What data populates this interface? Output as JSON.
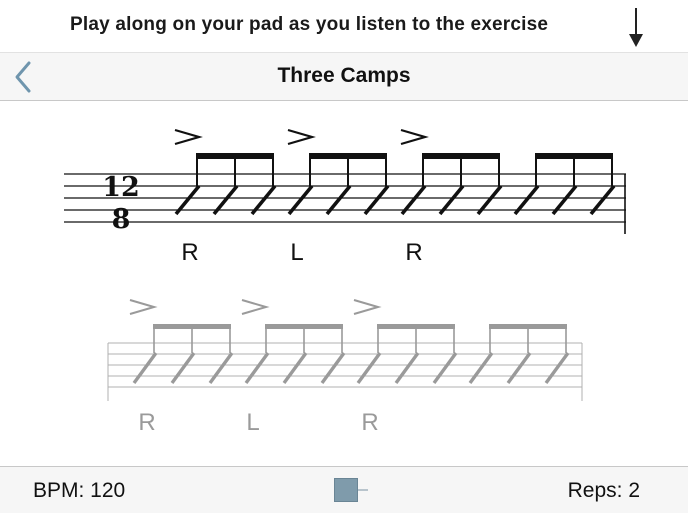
{
  "instruction": {
    "text": "Play along on your pad as you listen to the exercise",
    "icon": "down-arrow-icon"
  },
  "navbar": {
    "title": "Three Camps",
    "back_icon": "chevron-left-icon"
  },
  "notation": {
    "time_signature": {
      "top": "12",
      "bottom": "8"
    },
    "sticking": [
      "R",
      "L",
      "R"
    ],
    "accents": 3,
    "note_groups": 4,
    "notes_per_group": 3,
    "accent_color": "#111111",
    "ghost_color": "#9a9a9a"
  },
  "footer": {
    "bpm_label": "BPM: 120",
    "reps_label": "Reps: 2",
    "slider_color": "#7f9bab"
  }
}
